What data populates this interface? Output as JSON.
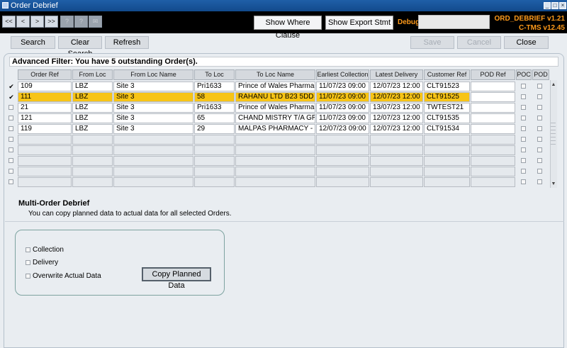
{
  "window": {
    "title": "Order Debrief"
  },
  "toolbar": {
    "nav": [
      "<<",
      "<",
      ">",
      ">>",
      "?",
      "?",
      "✉"
    ],
    "show_where_clause": "Show Where Clause",
    "show_export_stmt": "Show Export Stmt",
    "debug_label": "Debug",
    "debug_value": "",
    "version_line1": "ORD_DEBRIEF v1.21",
    "version_line2": "C-TMS v12.45"
  },
  "actions": {
    "search": "Search",
    "clear_search": "Clear Search",
    "refresh": "Refresh",
    "save": "Save",
    "cancel": "Cancel",
    "close": "Close"
  },
  "filter": {
    "text": "Advanced Filter: You have 5 outstanding Order(s)."
  },
  "grid": {
    "columns": [
      "Order Ref",
      "From Loc",
      "From Loc Name",
      "To Loc",
      "To Loc Name",
      "Earliest Collection",
      "Latest Delivery",
      "Customer Ref",
      "POD Ref",
      "POC",
      "POD"
    ],
    "rows": [
      {
        "selected": true,
        "highlighted": false,
        "cells": [
          "109",
          "LBZ",
          "Site 3",
          "Pri1633",
          "Prince of Wales Pharmacy",
          "11/07/23 09:00",
          "12/07/23 12:00",
          "CLT91523",
          ""
        ]
      },
      {
        "selected": true,
        "highlighted": true,
        "cells": [
          "111",
          "LBZ",
          "Site 3",
          "58",
          "RAHANU LTD B23 5DD",
          "11/07/23 09:00",
          "12/07/23 12:00",
          "CLT91525",
          ""
        ]
      },
      {
        "selected": false,
        "highlighted": false,
        "cells": [
          "21",
          "LBZ",
          "Site 3",
          "Pri1633",
          "Prince of Wales Pharmacy",
          "11/07/23 09:00",
          "13/07/23 12:00",
          "TWTEST21",
          ""
        ]
      },
      {
        "selected": false,
        "highlighted": false,
        "cells": [
          "121",
          "LBZ",
          "Site 3",
          "65",
          "CHAND MISTRY T/A GRA",
          "11/07/23 09:00",
          "12/07/23 12:00",
          "CLT91535",
          ""
        ]
      },
      {
        "selected": false,
        "highlighted": false,
        "cells": [
          "119",
          "LBZ",
          "Site 3",
          "29",
          "MALPAS PHARMACY - GE",
          "12/07/23 09:00",
          "12/07/23 12:00",
          "CLT91534",
          ""
        ]
      }
    ]
  },
  "multi": {
    "title": "Multi-Order Debrief",
    "description": "You can copy planned data to actual data for all selected Orders.",
    "options": [
      "Collection",
      "Delivery",
      "Overwrite Actual Data"
    ],
    "copy_button": "Copy Planned Data"
  },
  "colors": {
    "titlebar": "#1f5fa8",
    "highlight": "#f7c416",
    "version": "#ff9a1a"
  }
}
